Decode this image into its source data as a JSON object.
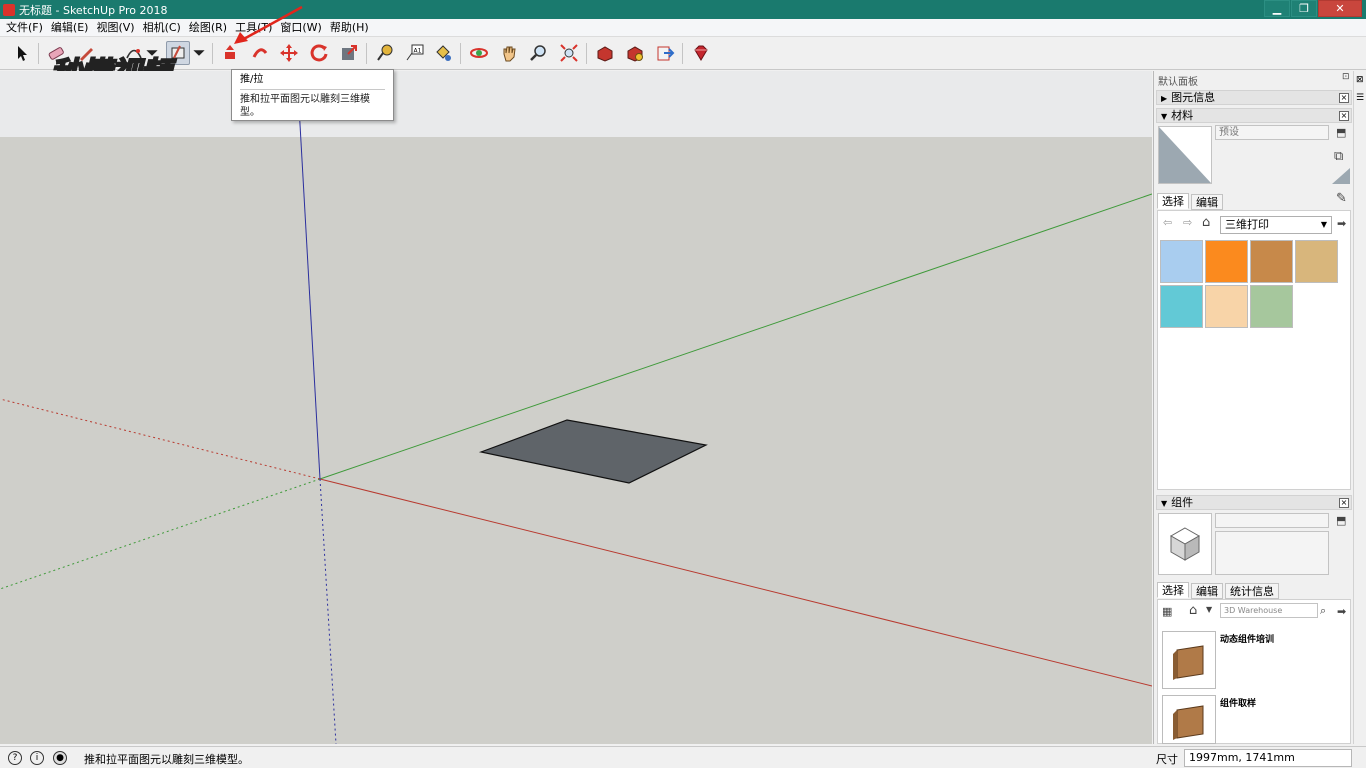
{
  "window": {
    "title": "无标题 - SketchUp Pro 2018",
    "buttons": {
      "minimize": "▁",
      "maximize": "❐",
      "close": "✕"
    }
  },
  "menu": [
    "文件(F)",
    "编辑(E)",
    "视图(V)",
    "相机(C)",
    "绘图(R)",
    "工具(T)",
    "窗口(W)",
    "帮助(H)"
  ],
  "toolbar": {
    "tools": [
      "select-icon",
      "eraser-icon",
      "pencil-icon",
      "paint-bucket-icon",
      "rectangle-icon",
      "push-pull-icon",
      "offset-icon",
      "move-icon",
      "rotate-icon",
      "scale-icon",
      "tape-measure-icon",
      "text-icon",
      "paint-icon",
      "orbit-icon",
      "pan-icon",
      "zoom-icon",
      "zoom-extents-icon",
      "warehouse-icon",
      "extension-warehouse-icon",
      "layout-send-icon",
      "ruby-icon"
    ],
    "active_tool": "push-pull-icon"
  },
  "watermark": "秒懂视频",
  "tooltip": {
    "title": "推/拉",
    "description": "推和拉平面图元以雕刻三维模型。"
  },
  "tray": {
    "title": "默认面板",
    "entity_info": {
      "title": "图元信息"
    },
    "materials": {
      "title": "材料",
      "name_placeholder": "预设",
      "tabs": [
        "选择",
        "编辑"
      ],
      "collection": "三维打印",
      "swatches": [
        "#a9cdef",
        "#fb8a1e",
        "#c7894a",
        "#d8b67c",
        "#62c9d6",
        "#f8d4a8",
        "#a6c79d"
      ]
    },
    "components": {
      "title": "组件",
      "tabs": [
        "选择",
        "编辑",
        "统计信息"
      ],
      "search_placeholder": "3D Warehouse",
      "items": [
        {
          "name": "动态组件培训"
        },
        {
          "name": "组件取样"
        }
      ]
    }
  },
  "status": {
    "hint": "推和拉平面图元以雕刻三维模型。",
    "measurement_label": "尺寸",
    "measurement_value": "1997mm, 1741mm"
  },
  "colors": {
    "title_bar": "#1a7a6e",
    "viewport_ground": "#cfcfca",
    "face": "#5f6469",
    "axis_red": "#b83a2f",
    "axis_green": "#3f9a3a",
    "axis_blue": "#2b2f9e"
  }
}
